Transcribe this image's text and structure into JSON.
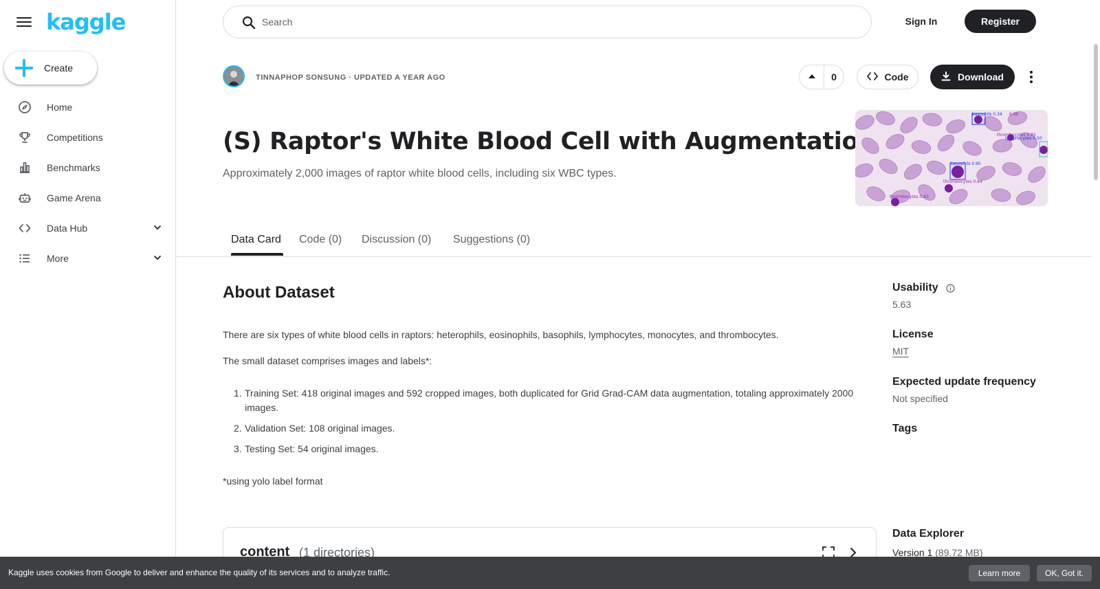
{
  "sidebar": {
    "logo": "kaggle",
    "create_label": "Create",
    "items": [
      {
        "label": "Home",
        "icon": "compass-icon"
      },
      {
        "label": "Competitions",
        "icon": "trophy-icon"
      },
      {
        "label": "Benchmarks",
        "icon": "bar-chart-icon"
      },
      {
        "label": "Game Arena",
        "icon": "robot-icon"
      },
      {
        "label": "Data Hub",
        "icon": "code-brackets-icon"
      },
      {
        "label": "More",
        "icon": "list-icon"
      }
    ]
  },
  "topbar": {
    "search_placeholder": "Search",
    "sign_in": "Sign In",
    "register": "Register"
  },
  "dataset": {
    "byline": "TINNAPHOP SONSUNG · UPDATED A YEAR AGO",
    "vote_count": "0",
    "code_label": "Code",
    "download_label": "Download",
    "title": "(S) Raptor's White Blood Cell with Augmentation",
    "subtitle": "Approximately 2,000 images of raptor white blood cells, including six WBC types."
  },
  "thumbnail_labels": {
    "l1": "basophils 0.34",
    "l2": "0.49",
    "l3": "thrombocytes 0.85",
    "l4": "lymphocytes 0.50",
    "l5": "basophils 0.95",
    "l6": "thrombocytes 0.84",
    "l7": "thrombocytes 0.83"
  },
  "tabs": [
    "Data Card",
    "Code (0)",
    "Discussion (0)",
    "Suggestions (0)"
  ],
  "about": {
    "heading": "About Dataset",
    "p1": "There are six types of white blood cells in raptors: heterophils, eosinophils, basophils, lymphocytes, monocytes, and thrombocytes.",
    "p2": "The small dataset comprises images and labels*:",
    "list": [
      "Training Set: 418 original images and 592 cropped images, both duplicated for Grid Grad-CAM data augmentation, totaling approximately 2000 images.",
      "Validation Set: 108 original images.",
      "Testing Set: 54 original images."
    ],
    "footnote": "*using yolo label format"
  },
  "content_card": {
    "title": "content",
    "count": "(1 directories)"
  },
  "meta": {
    "usability_label": "Usability",
    "usability_value": "5.63",
    "license_label": "License",
    "license_value": "MIT",
    "update_label": "Expected update frequency",
    "update_value": "Not specified",
    "tags_label": "Tags",
    "explorer_label": "Data Explorer",
    "version": "Version 1",
    "version_size": "(89.72 MB)"
  },
  "cookie": {
    "text": "Kaggle uses cookies from Google to deliver and enhance the quality of its services and to analyze traffic.",
    "learn_more": "Learn more",
    "ok": "OK, Got it."
  },
  "colors": {
    "accent": "#20beff",
    "dark": "#202124",
    "muted": "#5f6368",
    "border": "#dadce0",
    "cookie_bg": "#3c4043"
  }
}
